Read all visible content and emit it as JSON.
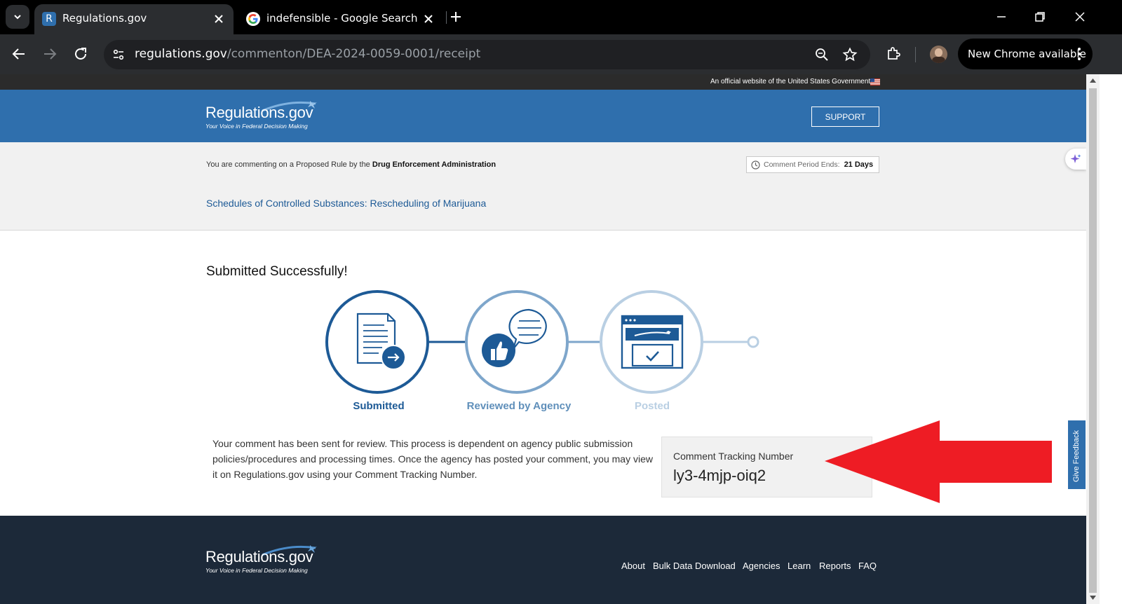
{
  "browser": {
    "tabs": [
      {
        "title": "Regulations.gov",
        "favicon": "R",
        "active": true
      },
      {
        "title": "indefensible - Google Search",
        "favicon": "google-g",
        "active": false
      }
    ],
    "url_host": "regulations.gov",
    "url_path": "/commenton/DEA-2024-0059-0001/receipt",
    "update_label": "New Chrome available"
  },
  "gov_banner": {
    "text": "An official website of the United States Government."
  },
  "header": {
    "logo_name": "Regulations.gov",
    "logo_tagline": "Your Voice in Federal Decision Making",
    "support_label": "SUPPORT"
  },
  "context": {
    "prefix": "You are commenting on a Proposed Rule by the",
    "agency": "Drug Enforcement Administration",
    "period_label": "Comment Period Ends:",
    "period_value": "21 Days",
    "document_title": "Schedules of Controlled Substances: Rescheduling of Marijuana"
  },
  "receipt": {
    "heading": "Submitted Successfully!",
    "steps": [
      {
        "label": "Submitted",
        "color": "#1d5a96"
      },
      {
        "label": "Reviewed by Agency",
        "color": "#5f8fba"
      },
      {
        "label": "Posted",
        "color": "#b9cfe3"
      }
    ],
    "description": "Your comment has been sent for review. This process is dependent on agency public submission policies/procedures and processing times. Once the agency has posted your comment, you may view it on Regulations.gov using your Comment Tracking Number.",
    "tracking_label": "Comment Tracking Number",
    "tracking_number": "ly3-4mjp-oiq2"
  },
  "footer": {
    "logo_name": "Regulations.gov",
    "logo_tagline": "Your Voice in Federal Decision Making",
    "links": [
      "About",
      "Bulk Data Download",
      "Agencies",
      "Learn",
      "Reports",
      "FAQ"
    ]
  },
  "feedback_label": "Give Feedback",
  "colors": {
    "brand_blue": "#2f6fad",
    "annotation_arrow": "#ee1c24",
    "footer_bg": "#1c2939"
  }
}
